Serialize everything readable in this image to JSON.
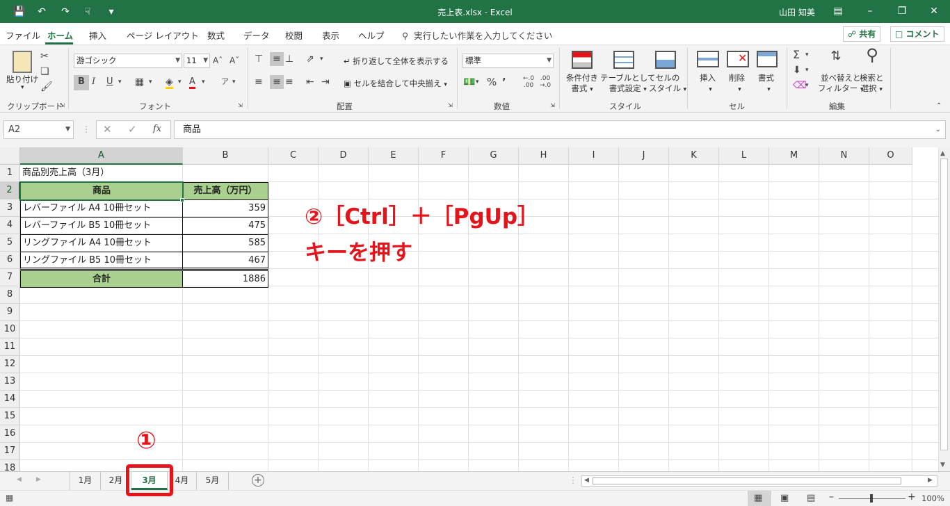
{
  "window": {
    "title": "売上表.xlsx  -  Excel",
    "user": "山田 知美"
  },
  "menu": {
    "items": [
      "ファイル",
      "ホーム",
      "挿入",
      "ページ レイアウト",
      "数式",
      "データ",
      "校閲",
      "表示",
      "ヘルプ"
    ],
    "active": "ホーム",
    "tell_me": "実行したい作業を入力してください",
    "share": "共有",
    "comment": "コメント"
  },
  "ribbon": {
    "clipboard": {
      "paste": "貼り付け",
      "label": "クリップボード"
    },
    "font": {
      "name": "游ゴシック",
      "size": "11",
      "bold": "B",
      "italic": "I",
      "underline": "U",
      "label": "フォント"
    },
    "alignment": {
      "wrap": "折り返して全体を表示する",
      "merge": "セルを結合して中央揃え",
      "label": "配置"
    },
    "number": {
      "format": "標準",
      "label": "数値"
    },
    "styles": {
      "conditional_1": "条件付き",
      "conditional_2": "書式",
      "table_1": "テーブルとして",
      "table_2": "書式設定",
      "cell_1": "セルの",
      "cell_2": "スタイル",
      "label": "スタイル"
    },
    "cells": {
      "insert": "挿入",
      "delete": "削除",
      "format": "書式",
      "label": "セル"
    },
    "editing": {
      "sort_1": "並べ替えと",
      "sort_2": "フィルター",
      "find_1": "検索と",
      "find_2": "選択",
      "label": "編集"
    }
  },
  "formula_bar": {
    "name_box": "A2",
    "content": "商品"
  },
  "grid": {
    "columns": [
      "A",
      "B",
      "C",
      "D",
      "E",
      "F",
      "G",
      "H",
      "I",
      "J",
      "K",
      "L",
      "M",
      "N",
      "O"
    ],
    "rows": [
      "1",
      "2",
      "3",
      "4",
      "5",
      "6",
      "7",
      "8",
      "9",
      "10",
      "11",
      "12",
      "13",
      "14",
      "15",
      "16",
      "17",
      "18"
    ],
    "title_cell": "商品別売上高（3月）",
    "header": {
      "product": "商品",
      "sales": "売上高（万円）"
    },
    "items": [
      {
        "product": "レバーファイル A4 10冊セット",
        "sales": "359"
      },
      {
        "product": "レバーファイル B5 10冊セット",
        "sales": "475"
      },
      {
        "product": "リングファイル A4 10冊セット",
        "sales": "585"
      },
      {
        "product": "リングファイル B5 10冊セット",
        "sales": "467"
      }
    ],
    "total": {
      "label": "合計",
      "value": "1886"
    }
  },
  "sheets": {
    "tabs": [
      "1月",
      "2月",
      "3月",
      "4月",
      "5月"
    ],
    "active": "3月"
  },
  "status": {
    "zoom": "100%"
  },
  "annotations": {
    "step1": "①",
    "step2_line1": "②［Ctrl］＋［PgUp］",
    "step2_line2": "キーを押す"
  },
  "colors": {
    "accent": "#217346",
    "header_fill": "#a9d08e",
    "annotation": "#e5141b"
  }
}
